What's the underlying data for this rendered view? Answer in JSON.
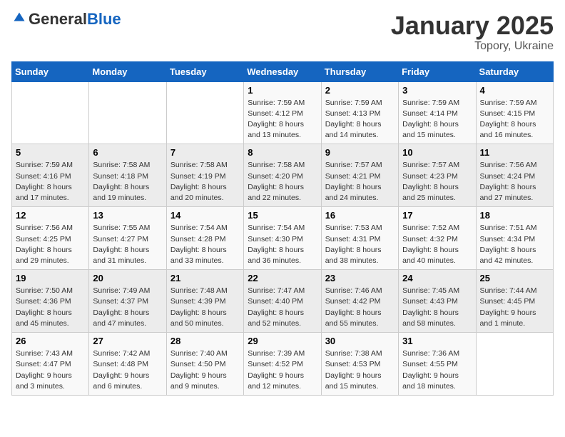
{
  "logo": {
    "general": "General",
    "blue": "Blue"
  },
  "header": {
    "month": "January 2025",
    "location": "Topory, Ukraine"
  },
  "weekdays": [
    "Sunday",
    "Monday",
    "Tuesday",
    "Wednesday",
    "Thursday",
    "Friday",
    "Saturday"
  ],
  "weeks": [
    [
      {
        "day": "",
        "info": ""
      },
      {
        "day": "",
        "info": ""
      },
      {
        "day": "",
        "info": ""
      },
      {
        "day": "1",
        "info": "Sunrise: 7:59 AM\nSunset: 4:12 PM\nDaylight: 8 hours\nand 13 minutes."
      },
      {
        "day": "2",
        "info": "Sunrise: 7:59 AM\nSunset: 4:13 PM\nDaylight: 8 hours\nand 14 minutes."
      },
      {
        "day": "3",
        "info": "Sunrise: 7:59 AM\nSunset: 4:14 PM\nDaylight: 8 hours\nand 15 minutes."
      },
      {
        "day": "4",
        "info": "Sunrise: 7:59 AM\nSunset: 4:15 PM\nDaylight: 8 hours\nand 16 minutes."
      }
    ],
    [
      {
        "day": "5",
        "info": "Sunrise: 7:59 AM\nSunset: 4:16 PM\nDaylight: 8 hours\nand 17 minutes."
      },
      {
        "day": "6",
        "info": "Sunrise: 7:58 AM\nSunset: 4:18 PM\nDaylight: 8 hours\nand 19 minutes."
      },
      {
        "day": "7",
        "info": "Sunrise: 7:58 AM\nSunset: 4:19 PM\nDaylight: 8 hours\nand 20 minutes."
      },
      {
        "day": "8",
        "info": "Sunrise: 7:58 AM\nSunset: 4:20 PM\nDaylight: 8 hours\nand 22 minutes."
      },
      {
        "day": "9",
        "info": "Sunrise: 7:57 AM\nSunset: 4:21 PM\nDaylight: 8 hours\nand 24 minutes."
      },
      {
        "day": "10",
        "info": "Sunrise: 7:57 AM\nSunset: 4:23 PM\nDaylight: 8 hours\nand 25 minutes."
      },
      {
        "day": "11",
        "info": "Sunrise: 7:56 AM\nSunset: 4:24 PM\nDaylight: 8 hours\nand 27 minutes."
      }
    ],
    [
      {
        "day": "12",
        "info": "Sunrise: 7:56 AM\nSunset: 4:25 PM\nDaylight: 8 hours\nand 29 minutes."
      },
      {
        "day": "13",
        "info": "Sunrise: 7:55 AM\nSunset: 4:27 PM\nDaylight: 8 hours\nand 31 minutes."
      },
      {
        "day": "14",
        "info": "Sunrise: 7:54 AM\nSunset: 4:28 PM\nDaylight: 8 hours\nand 33 minutes."
      },
      {
        "day": "15",
        "info": "Sunrise: 7:54 AM\nSunset: 4:30 PM\nDaylight: 8 hours\nand 36 minutes."
      },
      {
        "day": "16",
        "info": "Sunrise: 7:53 AM\nSunset: 4:31 PM\nDaylight: 8 hours\nand 38 minutes."
      },
      {
        "day": "17",
        "info": "Sunrise: 7:52 AM\nSunset: 4:32 PM\nDaylight: 8 hours\nand 40 minutes."
      },
      {
        "day": "18",
        "info": "Sunrise: 7:51 AM\nSunset: 4:34 PM\nDaylight: 8 hours\nand 42 minutes."
      }
    ],
    [
      {
        "day": "19",
        "info": "Sunrise: 7:50 AM\nSunset: 4:36 PM\nDaylight: 8 hours\nand 45 minutes."
      },
      {
        "day": "20",
        "info": "Sunrise: 7:49 AM\nSunset: 4:37 PM\nDaylight: 8 hours\nand 47 minutes."
      },
      {
        "day": "21",
        "info": "Sunrise: 7:48 AM\nSunset: 4:39 PM\nDaylight: 8 hours\nand 50 minutes."
      },
      {
        "day": "22",
        "info": "Sunrise: 7:47 AM\nSunset: 4:40 PM\nDaylight: 8 hours\nand 52 minutes."
      },
      {
        "day": "23",
        "info": "Sunrise: 7:46 AM\nSunset: 4:42 PM\nDaylight: 8 hours\nand 55 minutes."
      },
      {
        "day": "24",
        "info": "Sunrise: 7:45 AM\nSunset: 4:43 PM\nDaylight: 8 hours\nand 58 minutes."
      },
      {
        "day": "25",
        "info": "Sunrise: 7:44 AM\nSunset: 4:45 PM\nDaylight: 9 hours\nand 1 minute."
      }
    ],
    [
      {
        "day": "26",
        "info": "Sunrise: 7:43 AM\nSunset: 4:47 PM\nDaylight: 9 hours\nand 3 minutes."
      },
      {
        "day": "27",
        "info": "Sunrise: 7:42 AM\nSunset: 4:48 PM\nDaylight: 9 hours\nand 6 minutes."
      },
      {
        "day": "28",
        "info": "Sunrise: 7:40 AM\nSunset: 4:50 PM\nDaylight: 9 hours\nand 9 minutes."
      },
      {
        "day": "29",
        "info": "Sunrise: 7:39 AM\nSunset: 4:52 PM\nDaylight: 9 hours\nand 12 minutes."
      },
      {
        "day": "30",
        "info": "Sunrise: 7:38 AM\nSunset: 4:53 PM\nDaylight: 9 hours\nand 15 minutes."
      },
      {
        "day": "31",
        "info": "Sunrise: 7:36 AM\nSunset: 4:55 PM\nDaylight: 9 hours\nand 18 minutes."
      },
      {
        "day": "",
        "info": ""
      }
    ]
  ]
}
